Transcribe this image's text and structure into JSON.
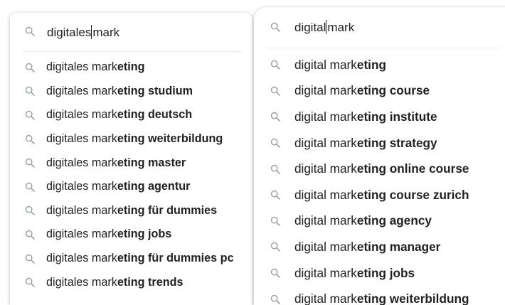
{
  "colors": {
    "icon": "#9aa0a6",
    "text": "#202124",
    "divider": "#e8eaed"
  },
  "left": {
    "query_before_caret": "digitales",
    "query_after_caret": "mark",
    "suggestions": [
      {
        "prefix": "digitales mark",
        "completion": "eting"
      },
      {
        "prefix": "digitales mark",
        "completion": "eting studium"
      },
      {
        "prefix": "digitales mark",
        "completion": "eting deutsch"
      },
      {
        "prefix": "digitales mark",
        "completion": "eting weiterbildung"
      },
      {
        "prefix": "digitales mark",
        "completion": "eting master"
      },
      {
        "prefix": "digitales mark",
        "completion": "eting agentur"
      },
      {
        "prefix": "digitales mark",
        "completion": "eting für dummies"
      },
      {
        "prefix": "digitales mark",
        "completion": "eting jobs"
      },
      {
        "prefix": "digitales mark",
        "completion": "eting für dummies pc"
      },
      {
        "prefix": "digitales mark",
        "completion": "eting trends"
      }
    ]
  },
  "right": {
    "query_before_caret": "digital",
    "query_after_caret": "mark",
    "suggestions": [
      {
        "prefix": "digital mark",
        "completion": "eting"
      },
      {
        "prefix": "digital mark",
        "completion": "eting course"
      },
      {
        "prefix": "digital mark",
        "completion": "eting institute"
      },
      {
        "prefix": "digital mark",
        "completion": "eting strategy"
      },
      {
        "prefix": "digital mark",
        "completion": "eting online course"
      },
      {
        "prefix": "digital mark",
        "completion": "eting course zurich"
      },
      {
        "prefix": "digital mark",
        "completion": "eting agency"
      },
      {
        "prefix": "digital mark",
        "completion": "eting manager"
      },
      {
        "prefix": "digital mark",
        "completion": "eting jobs"
      },
      {
        "prefix": "digital mark",
        "completion": "eting weiterbildung"
      }
    ]
  }
}
